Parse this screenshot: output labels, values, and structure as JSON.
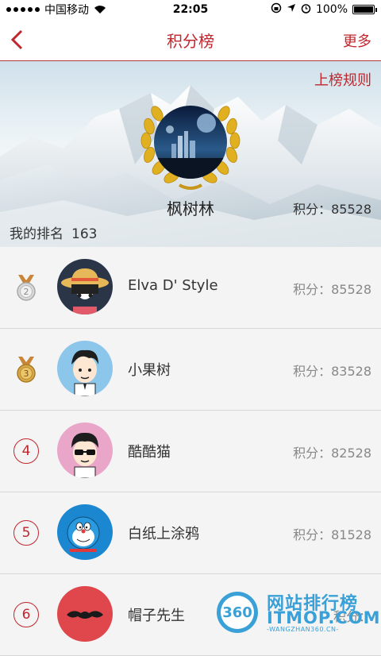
{
  "status_bar": {
    "carrier": "中国移动",
    "time": "22:05",
    "battery": "100%",
    "battery_level": 1.0
  },
  "nav": {
    "title": "积分榜",
    "more": "更多"
  },
  "hero": {
    "rules_link": "上榜规则",
    "name": "枫树林",
    "score": "积分：85528",
    "my_rank_label": "我的排名",
    "my_rank_value": "163"
  },
  "rankings": [
    {
      "rank": "2",
      "badge": "silver-medal",
      "name": "Elva D' Style",
      "score": "积分：85528",
      "avatar": "straw-hat-girl"
    },
    {
      "rank": "3",
      "badge": "bronze-medal",
      "name": "小果树",
      "score": "积分：83528",
      "avatar": "cartoon-boy"
    },
    {
      "rank": "4",
      "badge": "circle",
      "name": "酷酷猫",
      "score": "积分：82528",
      "avatar": "sunglasses-boy"
    },
    {
      "rank": "5",
      "badge": "circle",
      "name": "白纸上涂鸦",
      "score": "积分：81528",
      "avatar": "doraemon"
    },
    {
      "rank": "6",
      "badge": "circle",
      "name": "帽子先生",
      "score": "积分：",
      "avatar": "mustache"
    }
  ],
  "watermark": {
    "logo_text": "360",
    "line1": "网站排行榜",
    "line2": "ITMOP.COM",
    "line3": "-WANGZHAN360.CN-"
  },
  "colors": {
    "accent": "#c0262d",
    "list_bg": "#f4f4f4",
    "watermark": "#3aa0d8"
  }
}
